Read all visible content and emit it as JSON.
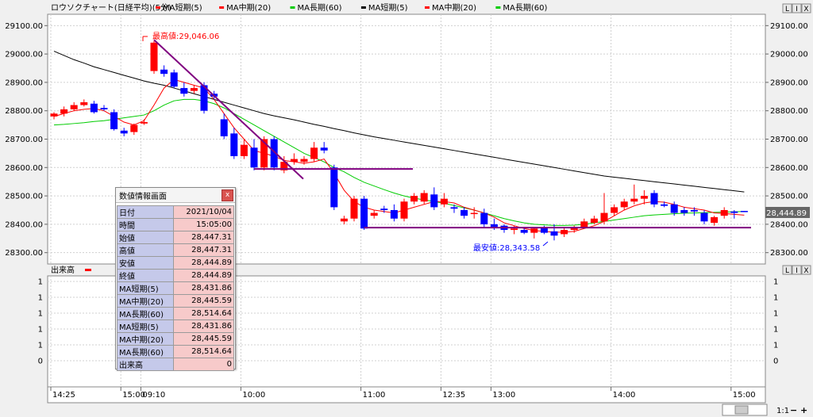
{
  "legend": {
    "chart_label": "ロウソクチャート(日経平均)(5分)",
    "items": [
      {
        "label": "MA短期(5)",
        "color": "#ff0000"
      },
      {
        "label": "MA中期(20)",
        "color": "#ff0000"
      },
      {
        "label": "MA長期(60)",
        "color": "#00cc00"
      },
      {
        "label": "MA短期(5)",
        "color": "#000000"
      },
      {
        "label": "MA中期(20)",
        "color": "#ff0000"
      },
      {
        "label": "MA長期(60)",
        "color": "#00cc00"
      }
    ],
    "volume_label": "出来高"
  },
  "price_tag": "28,444.89",
  "annotations": {
    "high": "最高値:29,046.06",
    "low": "最安値:28,343.58"
  },
  "window_buttons": [
    "L",
    "I",
    "X"
  ],
  "zoom_label": "1:1",
  "zoom_minus": "−",
  "zoom_plus": "+",
  "info_panel": {
    "title": "数値情報画面",
    "close": "x",
    "rows": [
      {
        "k": "日付",
        "v": "2021/10/04"
      },
      {
        "k": "時間",
        "v": "15:05:00"
      },
      {
        "k": "始値",
        "v": "28,447.31"
      },
      {
        "k": "高値",
        "v": "28,447.31"
      },
      {
        "k": "安値",
        "v": "28,444.89"
      },
      {
        "k": "終値",
        "v": "28,444.89"
      },
      {
        "k": "MA短期(5)",
        "v": "28,431.86"
      },
      {
        "k": "MA中期(20)",
        "v": "28,445.59"
      },
      {
        "k": "MA長期(60)",
        "v": "28,514.64"
      },
      {
        "k": "MA短期(5)",
        "v": "28,431.86"
      },
      {
        "k": "MA中期(20)",
        "v": "28,445.59"
      },
      {
        "k": "MA長期(60)",
        "v": "28,514.64"
      },
      {
        "k": "出来高",
        "v": "0"
      }
    ]
  },
  "colors": {
    "up": "#ff0000",
    "down": "#0000ff",
    "ma_short": "#ff0000",
    "ma_mid": "#00cc00",
    "ma_long": "#000000",
    "trend": "#800080"
  },
  "chart_data": {
    "type": "candlestick",
    "ylim": [
      28260,
      29140
    ],
    "yticks": [
      28300,
      28400,
      28500,
      28600,
      28700,
      28800,
      28900,
      29000,
      29100
    ],
    "ytick_labels": [
      "28300.00",
      "28400.00",
      "28500.00",
      "28600.00",
      "28700.00",
      "28800.00",
      "28900.00",
      "29000.00",
      "29100.00"
    ],
    "xtick_labels": [
      {
        "label": "14:25",
        "i": 0
      },
      {
        "label": "15:00",
        "i": 7
      },
      {
        "label": "09:10",
        "i": 9
      },
      {
        "label": "10:00",
        "i": 19
      },
      {
        "label": "11:00",
        "i": 31
      },
      {
        "label": "12:35",
        "i": 39
      },
      {
        "label": "13:00",
        "i": 44
      },
      {
        "label": "14:00",
        "i": 56
      },
      {
        "label": "15:00",
        "i": 68
      }
    ],
    "volume_yticks": [
      0,
      1,
      1,
      1,
      1,
      1
    ],
    "candles": [
      [
        28780,
        28795,
        28770,
        28790
      ],
      [
        28790,
        28815,
        28780,
        28805
      ],
      [
        28805,
        28830,
        28800,
        28820
      ],
      [
        28820,
        28840,
        28815,
        28830
      ],
      [
        28825,
        28835,
        28790,
        28795
      ],
      [
        28810,
        28820,
        28800,
        28805
      ],
      [
        28795,
        28805,
        28730,
        28735
      ],
      [
        28730,
        28740,
        28710,
        28720
      ],
      [
        28725,
        28755,
        28715,
        28750
      ],
      [
        28755,
        28770,
        28750,
        28760
      ],
      [
        28940,
        29046,
        28930,
        29040
      ],
      [
        28945,
        28960,
        28920,
        28930
      ],
      [
        28935,
        28945,
        28880,
        28885
      ],
      [
        28880,
        28900,
        28850,
        28860
      ],
      [
        28870,
        28890,
        28860,
        28880
      ],
      [
        28890,
        28900,
        28790,
        28800
      ],
      [
        28860,
        28870,
        28840,
        28850
      ],
      [
        28770,
        28790,
        28700,
        28710
      ],
      [
        28720,
        28740,
        28630,
        28640
      ],
      [
        28640,
        28700,
        28630,
        28680
      ],
      [
        28670,
        28700,
        28590,
        28600
      ],
      [
        28600,
        28710,
        28590,
        28700
      ],
      [
        28700,
        28710,
        28590,
        28600
      ],
      [
        28590,
        28640,
        28580,
        28620
      ],
      [
        28620,
        28650,
        28610,
        28630
      ],
      [
        28620,
        28640,
        28610,
        28630
      ],
      [
        28630,
        28690,
        28620,
        28670
      ],
      [
        28670,
        28690,
        28650,
        28660
      ],
      [
        28600,
        28610,
        28450,
        28460
      ],
      [
        28410,
        28430,
        28400,
        28420
      ],
      [
        28420,
        28500,
        28410,
        28490
      ],
      [
        28490,
        28500,
        28380,
        28385
      ],
      [
        28430,
        28450,
        28420,
        28440
      ],
      [
        28455,
        28465,
        28440,
        28450
      ],
      [
        28450,
        28470,
        28410,
        28420
      ],
      [
        28420,
        28490,
        28410,
        28480
      ],
      [
        28480,
        28510,
        28470,
        28500
      ],
      [
        28480,
        28520,
        28470,
        28510
      ],
      [
        28505,
        28530,
        28450,
        28460
      ],
      [
        28470,
        28510,
        28460,
        28490
      ],
      [
        28460,
        28470,
        28440,
        28455
      ],
      [
        28450,
        28460,
        28420,
        28430
      ],
      [
        28440,
        28460,
        28420,
        28440
      ],
      [
        28440,
        28455,
        28390,
        28400
      ],
      [
        28400,
        28420,
        28380,
        28390
      ],
      [
        28395,
        28400,
        28370,
        28380
      ],
      [
        28380,
        28395,
        28365,
        28385
      ],
      [
        28380,
        28390,
        28365,
        28370
      ],
      [
        28370,
        28390,
        28350,
        28385
      ],
      [
        28390,
        28395,
        28365,
        28370
      ],
      [
        28375,
        28400,
        28343,
        28360
      ],
      [
        28365,
        28390,
        28355,
        28380
      ],
      [
        28380,
        28395,
        28370,
        28390
      ],
      [
        28390,
        28420,
        28385,
        28410
      ],
      [
        28405,
        28430,
        28400,
        28420
      ],
      [
        28410,
        28510,
        28400,
        28440
      ],
      [
        28440,
        28470,
        28430,
        28460
      ],
      [
        28460,
        28490,
        28450,
        28480
      ],
      [
        28480,
        28540,
        28470,
        28490
      ],
      [
        28490,
        28520,
        28470,
        28500
      ],
      [
        28510,
        28520,
        28460,
        28470
      ],
      [
        28470,
        28480,
        28460,
        28465
      ],
      [
        28470,
        28480,
        28430,
        28440
      ],
      [
        28450,
        28460,
        28430,
        28440
      ],
      [
        28450,
        28460,
        28430,
        28445
      ],
      [
        28440,
        28450,
        28400,
        28410
      ],
      [
        28405,
        28430,
        28395,
        28425
      ],
      [
        28430,
        28460,
        28420,
        28450
      ],
      [
        28445,
        28450,
        28420,
        28440
      ],
      [
        28447,
        28447,
        28444,
        28445
      ]
    ],
    "ma_short": [
      28780,
      28790,
      28800,
      28805,
      28808,
      28800,
      28780,
      28760,
      28750,
      28765,
      28820,
      28880,
      28910,
      28900,
      28890,
      28880,
      28840,
      28790,
      28740,
      28700,
      28660,
      28650,
      28640,
      28625,
      28620,
      28615,
      28620,
      28630,
      28580,
      28520,
      28480,
      28460,
      28450,
      28445,
      28440,
      28450,
      28460,
      28470,
      28480,
      28480,
      28475,
      28460,
      28450,
      28440,
      28425,
      28405,
      28395,
      28385,
      28378,
      28375,
      28372,
      28372,
      28375,
      28385,
      28395,
      28410,
      28430,
      28450,
      28465,
      28475,
      28480,
      28478,
      28470,
      28460,
      28455,
      28450,
      28440,
      28438,
      28435,
      28432
    ],
    "ma_mid": [
      28750,
      28752,
      28755,
      28758,
      28762,
      28765,
      28770,
      28775,
      28780,
      28785,
      28800,
      28820,
      28835,
      28840,
      28840,
      28835,
      28825,
      28810,
      28790,
      28770,
      28750,
      28730,
      28710,
      28690,
      28670,
      28650,
      28635,
      28620,
      28600,
      28585,
      28565,
      28548,
      28535,
      28522,
      28510,
      28500,
      28492,
      28486,
      28480,
      28474,
      28466,
      28458,
      28450,
      28440,
      28430,
      28420,
      28412,
      28405,
      28400,
      28398,
      28396,
      28396,
      28397,
      28400,
      28405,
      28410,
      28415,
      28420,
      28425,
      28430,
      28433,
      28435,
      28437,
      28439,
      28440,
      28441,
      28442,
      28443,
      28444,
      28445
    ],
    "ma_long": [
      29010,
      28995,
      28980,
      28968,
      28955,
      28945,
      28935,
      28925,
      28915,
      28905,
      28897,
      28890,
      28880,
      28870,
      28860,
      28850,
      28840,
      28830,
      28820,
      28810,
      28800,
      28790,
      28782,
      28775,
      28768,
      28760,
      28752,
      28745,
      28737,
      28730,
      28722,
      28715,
      28708,
      28702,
      28696,
      28690,
      28684,
      28678,
      28672,
      28666,
      28660,
      28654,
      28648,
      28642,
      28636,
      28630,
      28624,
      28618,
      28612,
      28606,
      28600,
      28594,
      28588,
      28582,
      28576,
      28570,
      28566,
      28562,
      28558,
      28554,
      28550,
      28546,
      28542,
      28538,
      28534,
      28530,
      28526,
      28522,
      28518,
      28514
    ]
  }
}
